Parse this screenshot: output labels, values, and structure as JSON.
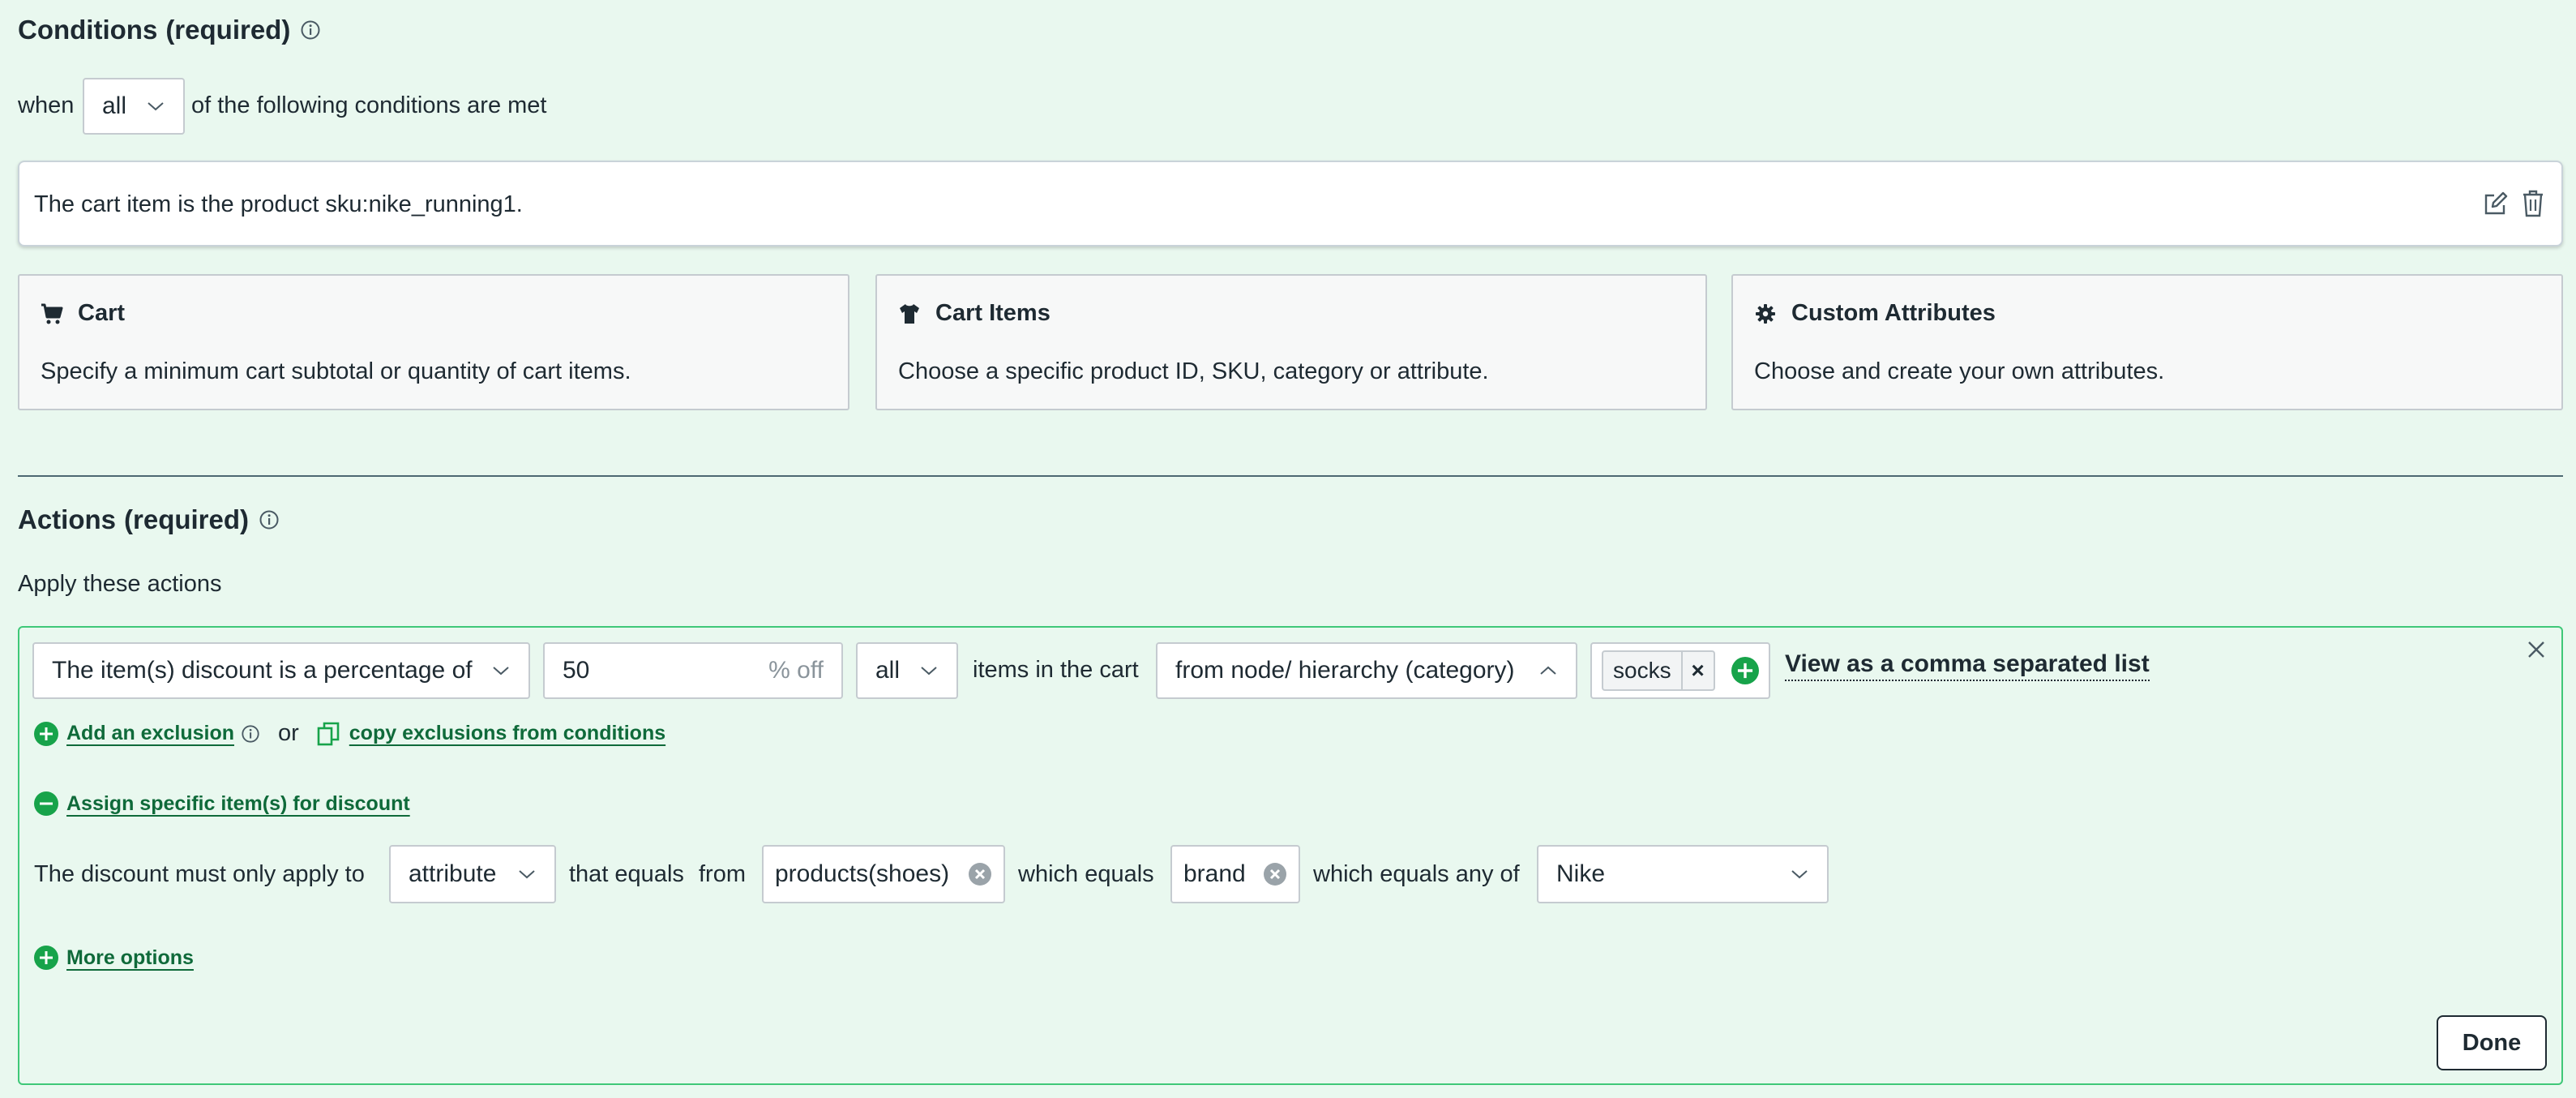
{
  "conditions": {
    "title": "Conditions",
    "required": "(required)",
    "when_label": "when",
    "match_select": "all",
    "following_label": "of the following conditions are met",
    "rule_text": "The cart item is the product sku:nike_running1.",
    "options": [
      {
        "title": "Cart",
        "description": "Specify a minimum cart subtotal or quantity of cart items.",
        "icon": "cart-icon"
      },
      {
        "title": "Cart Items",
        "description": "Choose a specific product ID, SKU, category or attribute.",
        "icon": "shirt-icon"
      },
      {
        "title": "Custom Attributes",
        "description": "Choose and create your own attributes.",
        "icon": "gear-icon"
      }
    ]
  },
  "actions": {
    "title": "Actions",
    "required": "(required)",
    "apply_label": "Apply these actions",
    "discount_type_select": "The item(s) discount is a percentage of",
    "discount_value": "50",
    "discount_suffix": "% off",
    "items_select": "all",
    "items_label": "items in the cart",
    "scope_select": "from node/ hierarchy (category)",
    "tag": "socks",
    "tag_remove": "×",
    "view_list_link": "View as a comma separated list",
    "add_exclusion_link": "Add an exclusion",
    "or_label": "or",
    "copy_exclusions_link": "copy exclusions from conditions",
    "assign_link": "Assign specific item(s) for discount",
    "apply_to_label": "The discount must only apply to",
    "apply_to_select": "attribute",
    "that_equals_label": "that equals",
    "from_label": "from",
    "from_chip": "products(shoes)",
    "which_equals_label": "which equals",
    "which_chip": "brand",
    "any_of_label": "which equals any of",
    "any_of_select": "Nike",
    "more_options_link": "More options",
    "done_button": "Done"
  },
  "colors": {
    "background": "#e9f8ef",
    "accent_green": "#17a34a",
    "link_green": "#0f6a3a",
    "panel_border": "#3fc878",
    "text": "#1e2a32"
  }
}
